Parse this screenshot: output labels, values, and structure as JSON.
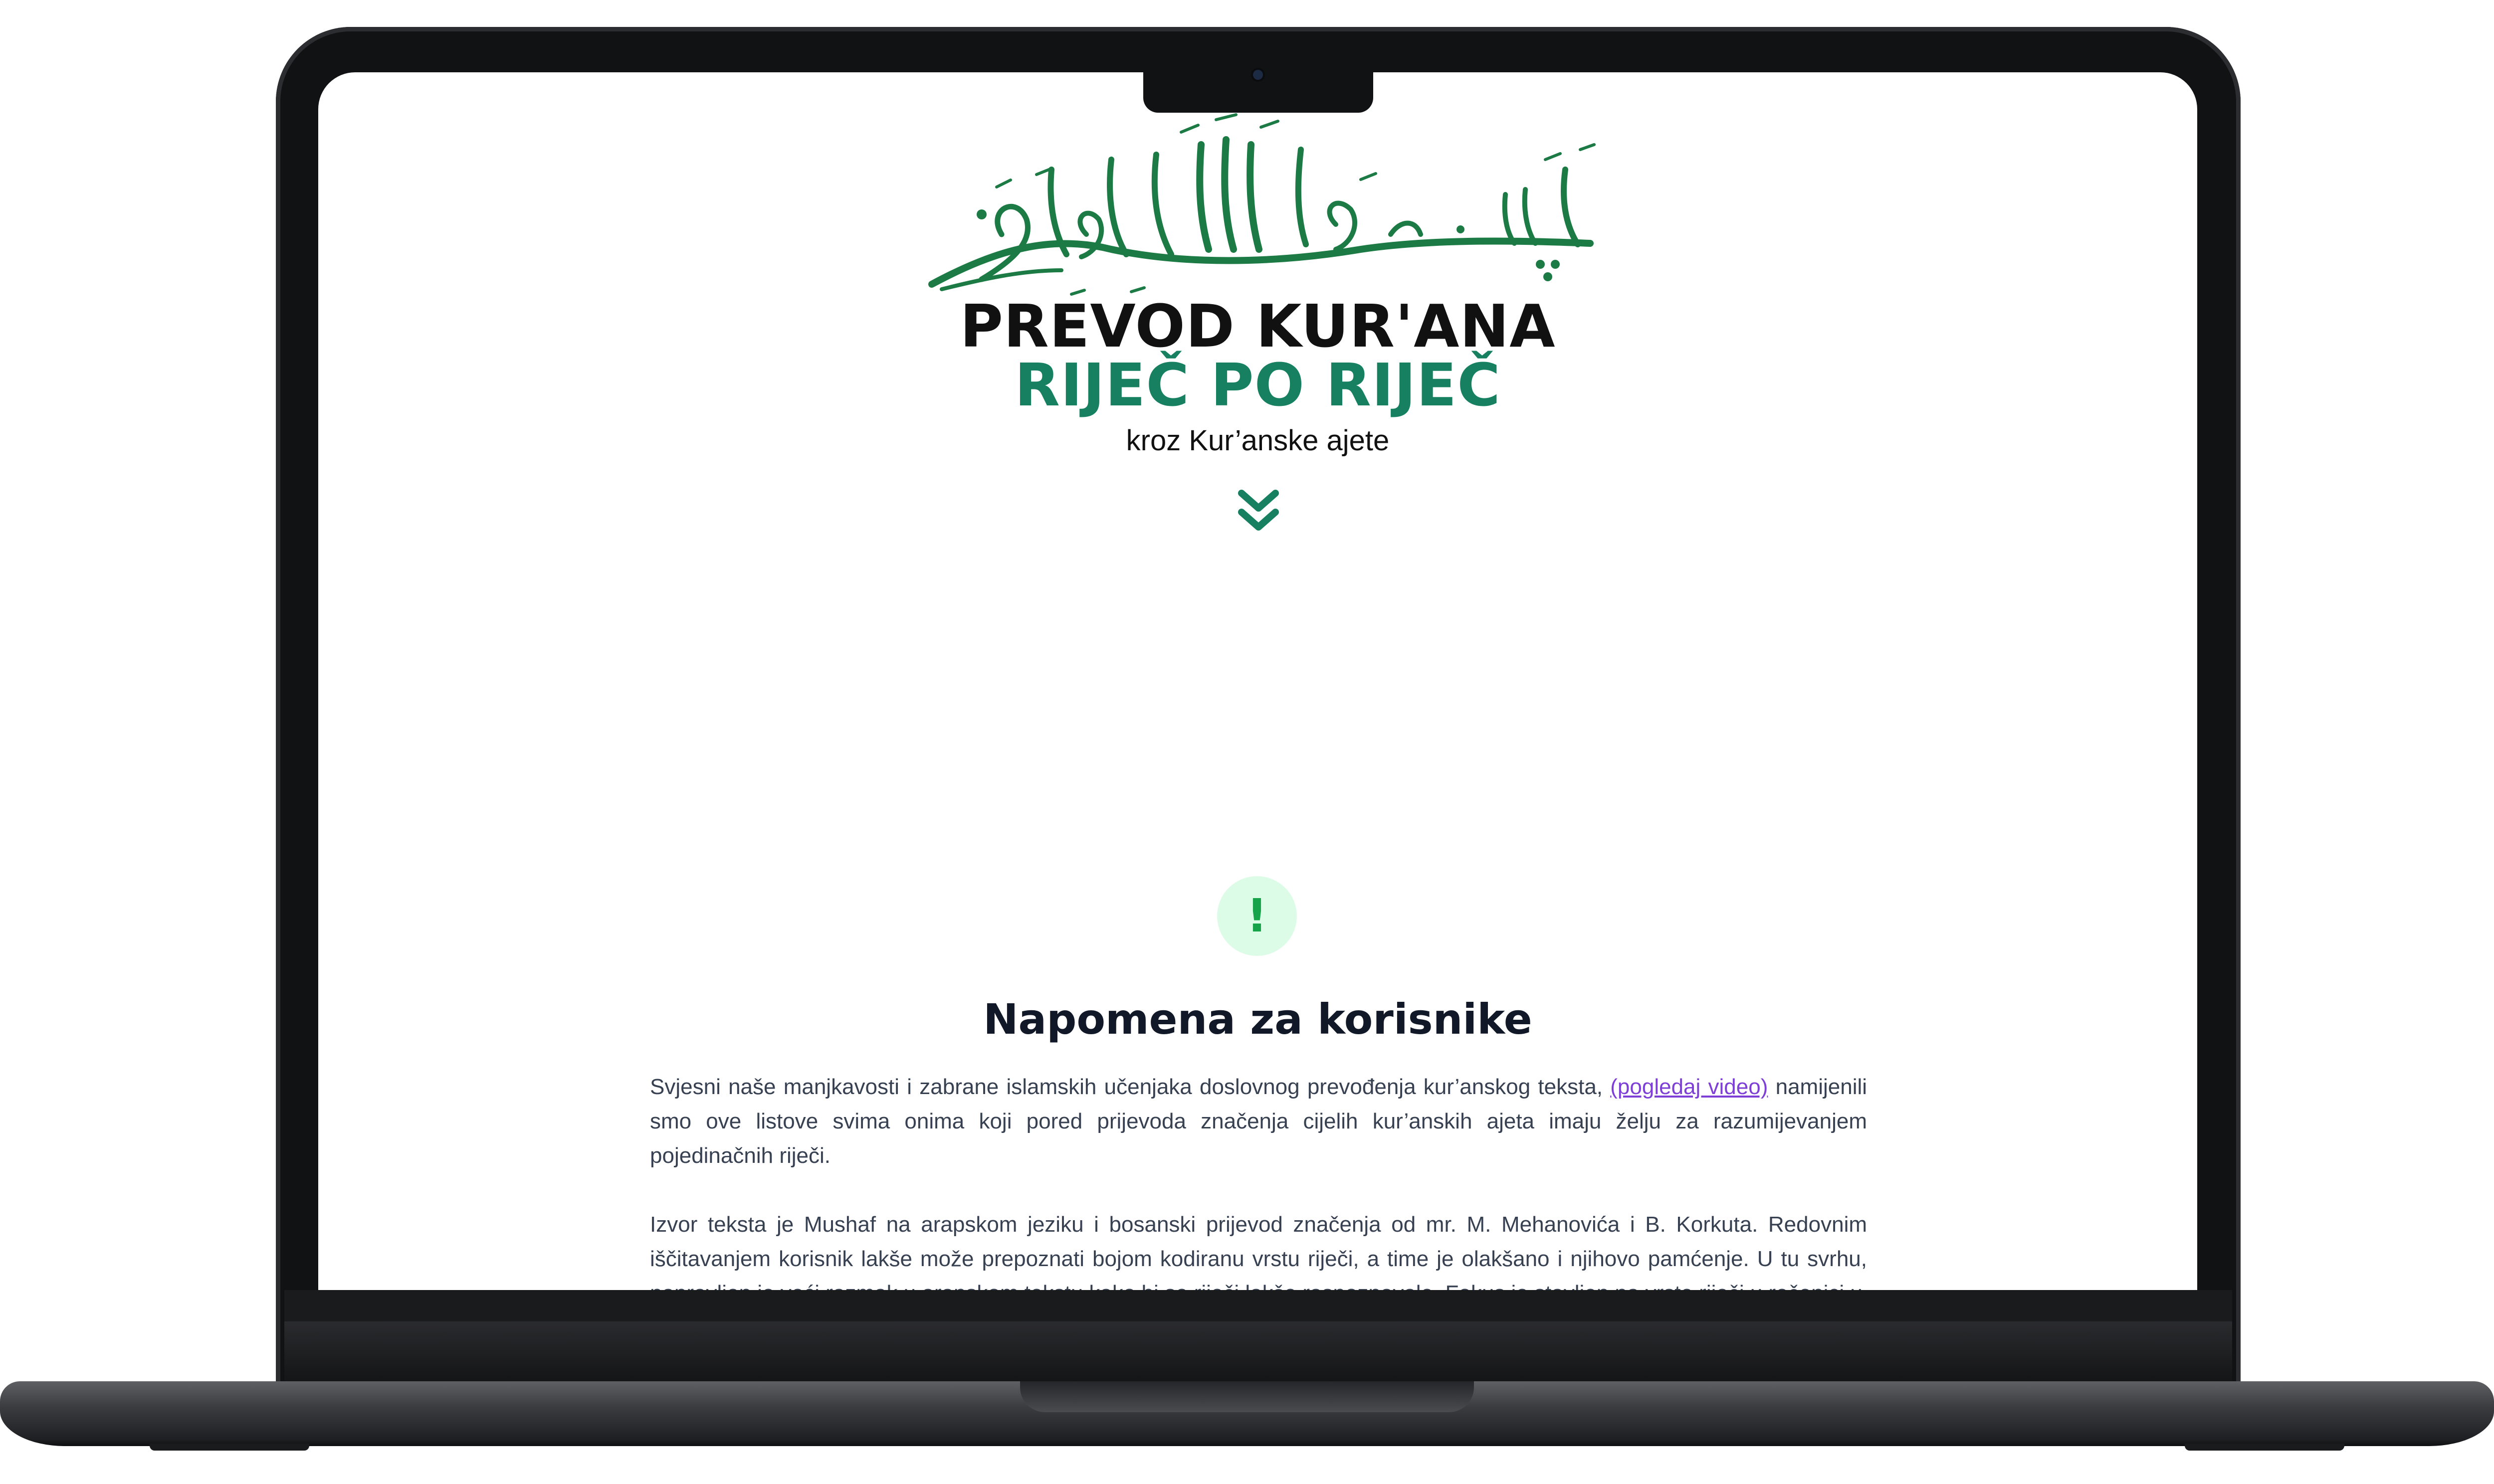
{
  "header": {
    "calligraphy": "بِسْمِ اللَّهِ الرَّحْمَٰنِ الرَّحِيمِ",
    "title_line1": "PREVOD KUR'ANA",
    "title_line2": "RIJEČ PO RIJEČ",
    "subtitle": "kroz Kur’anske ajete",
    "scroll_icon": "double-chevron-down-icon"
  },
  "notice": {
    "icon": "exclamation-icon",
    "icon_text": "!",
    "title": "Napomena za korisnike",
    "paragraph1_before_link": "Svjesni naše manjkavosti i zabrane islamskih učenjaka doslovnog prevođenja kur’anskog teksta, ",
    "paragraph1_link": "(pogledaj video)",
    "paragraph1_after_link": " namijenili smo ove listove svima onima koji pored prijevoda značenja cijelih kur’anskih ajeta imaju želju za razumijevanjem pojedinačnih riječi.",
    "paragraph2": "Izvor teksta je Mushaf na arapskom jeziku i bosanski prijevod značenja od mr. M. Mehanovića i B. Korkuta. Redovnim iščitavanjem korisnik lakše može prepoznati bojom kodiranu vrstu riječi, a time je olakšano i njihovo pamćenje. U tu svrhu, napravljen je veći razmak u arapskom tekstu kako bi se riječi lakše raspoznavale. Fokus je stavljen na vrste riječi u rečenici u"
  },
  "colors": {
    "brand_green": "#168060",
    "alert_bg": "#dcfce7",
    "alert_fg": "#16a34a",
    "link": "#7e3fd6"
  }
}
